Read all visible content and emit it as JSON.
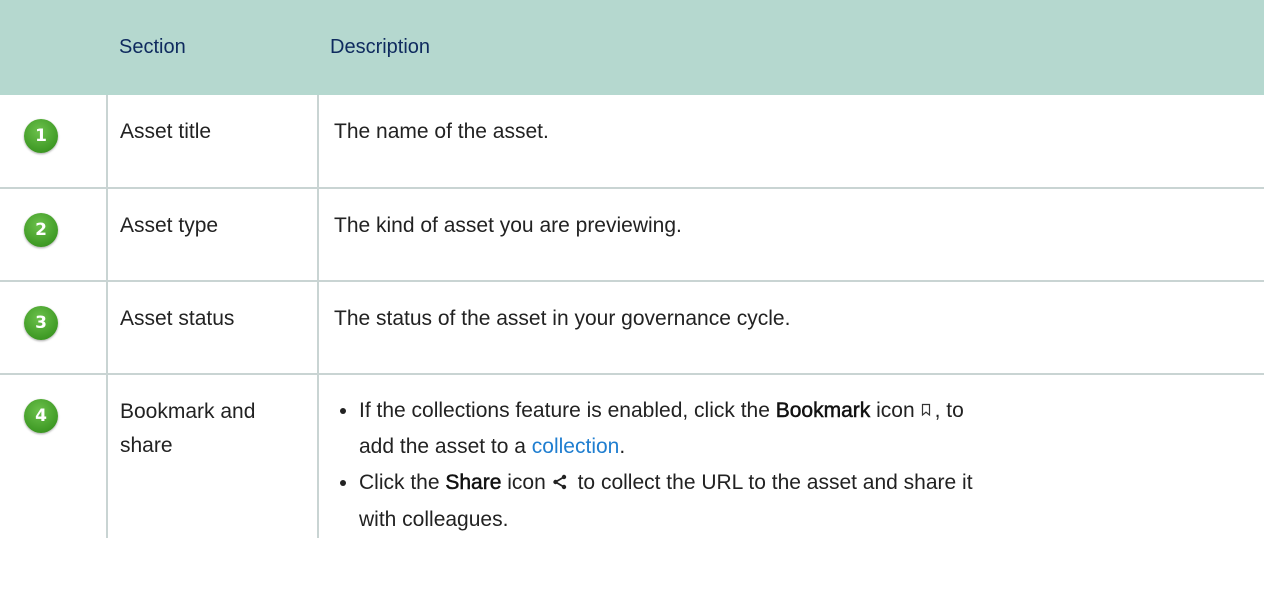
{
  "table": {
    "headers": {
      "section": "Section",
      "description": "Description"
    },
    "rows": [
      {
        "number": "1",
        "section": "Asset title",
        "description": "The name of the asset."
      },
      {
        "number": "2",
        "section": "Asset type",
        "description": "The kind of asset you are previewing."
      },
      {
        "number": "3",
        "section": "Asset status",
        "description": "The status of the asset in your governance cycle."
      },
      {
        "number": "4",
        "section_line1": "Bookmark and",
        "section_line2": "share",
        "bullets": [
          {
            "prefix": "If the collections feature is enabled, click the ",
            "bold": "Bookmark",
            "after_bold": " icon",
            "icon": "bookmark-icon",
            "after_icon": ", to",
            "line2_prefix": "add the asset to a ",
            "link": "collection",
            "line2_suffix": "."
          },
          {
            "prefix": "Click the ",
            "bold": "Share",
            "after_bold": " icon",
            "icon": "share-icon",
            "after_icon": " to collect the URL to the asset and share it",
            "line2_prefix": "with colleagues."
          }
        ]
      }
    ]
  },
  "colors": {
    "header_bg": "#b5d8cf",
    "header_text": "#0e2a5e",
    "badge_green": "#3f9a25",
    "link": "#1f7ed0"
  }
}
